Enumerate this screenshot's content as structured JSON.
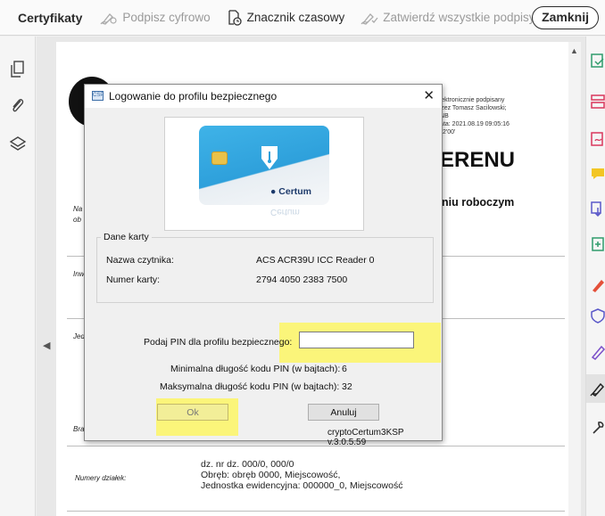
{
  "toolbar": {
    "title": "Certyfikaty",
    "sign_digital": "Podpisz cyfrowo",
    "timestamp": "Znacznik czasowy",
    "validate_all": "Zatwierdź wszystkie podpisy",
    "close": "Zamknij"
  },
  "left_sidebar": {
    "icons": [
      "pages-icon",
      "attachment-icon",
      "layers-icon"
    ]
  },
  "right_tools": {
    "icons": [
      "export-pdf-icon",
      "organize-pages-icon",
      "create-pdf-icon",
      "comment-icon",
      "combine-files-icon",
      "edit-pdf-icon",
      "fill-sign-icon",
      "protect-icon",
      "request-signatures-icon",
      "certificates-icon",
      "tools-icon"
    ],
    "selected": "certificates-icon"
  },
  "document": {
    "signature_block": [
      "Elektronicznie podpisany",
      "przez Tomasz Sacilowski;",
      "UNB",
      "Data: 2021.08.19 09:05:16",
      "+02'00'"
    ],
    "heading_fragment": "ERENU",
    "subheading_fragment": "niu roboczym",
    "left_labels": [
      "Na",
      "ob",
      "Inwe",
      "Jedn",
      "Bra"
    ],
    "parcel_label": "Numery działek:",
    "parcel_lines": [
      "dz. nr  dz. 000/0, 000/0",
      "Obręb: obręb 0000, Miejscowość,",
      "Jednostka ewidencyjna: 000000_0, Miejscowość"
    ]
  },
  "dialog": {
    "title": "Logowanie do profilu bezpiecznego",
    "close_glyph": "✕",
    "app_icon_text": "CSP",
    "card_brand": "Certum",
    "card_reflection": "Certum",
    "group_label": "Dane karty",
    "reader_label": "Nazwa czytnika:",
    "reader_value": "ACS ACR39U ICC Reader 0",
    "card_number_label": "Numer karty:",
    "card_number_value": "2794 4050 2383 7500",
    "pin_label": "Podaj PIN dla profilu bezpiecznego:",
    "pin_value": "",
    "min_label": "Minimalna długość kodu PIN (w bajtach):",
    "min_value": "6",
    "max_label": "Maksymalna długość kodu PIN (w bajtach):",
    "max_value": "32",
    "ok_label": "Ok",
    "cancel_label": "Anuluj",
    "version": "cryptoCertum3KSP v.3.0.5.59"
  },
  "colors": {
    "highlight": "#fbf57a",
    "card_blue": "#2ea0db",
    "brand_navy": "#1d3a6b"
  }
}
